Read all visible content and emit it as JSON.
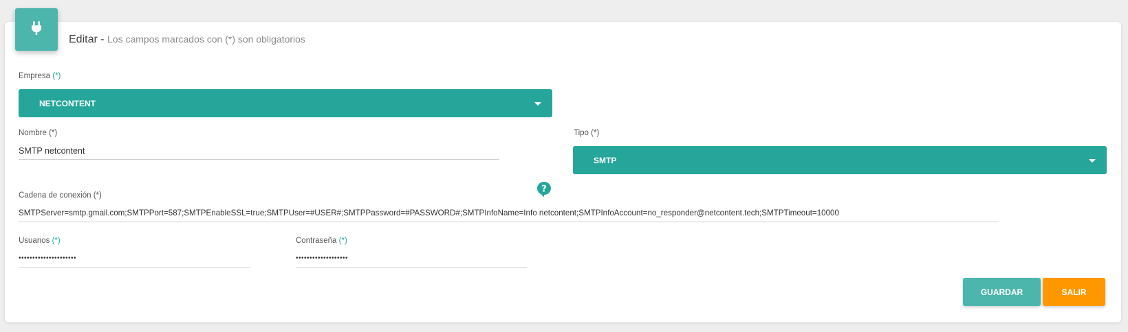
{
  "header": {
    "title": "Editar",
    "separator": " - ",
    "subtitle": "Los campos marcados con (*) son obligatorios",
    "icon": "plug-icon"
  },
  "form": {
    "empresa": {
      "label": "Empresa",
      "required_mark": "(*)",
      "value": "NETCONTENT"
    },
    "nombre": {
      "label": "Nombre (*)",
      "value": "SMTP netcontent"
    },
    "tipo": {
      "label": "Tipo (*)",
      "value": "SMTP"
    },
    "cadena": {
      "label": "Cadena de conexión (*)",
      "value": "SMTPServer=smtp.gmail.com;SMTPPort=587;SMTPEnableSSL=true;SMTPUser=#USER#;SMTPPassword=#PASSWORD#;SMTPInfoName=Info netcontent;SMTPInfoAccount=no_responder@netcontent.tech;SMTPTimeout=10000",
      "help_icon": "help-bubble-icon"
    },
    "usuarios": {
      "label": "Usuarios",
      "required_mark": "(*)",
      "value": "•••••••••••••••••••••"
    },
    "contrasena": {
      "label": "Contraseña",
      "required_mark": "(*)",
      "value": "•••••••••••••••••••"
    }
  },
  "actions": {
    "save_label": "GUARDAR",
    "exit_label": "SALIR"
  },
  "colors": {
    "primary": "#26a69a",
    "primary_light": "#4db6ac",
    "accent": "#ff9800",
    "background": "#eeeeee"
  }
}
